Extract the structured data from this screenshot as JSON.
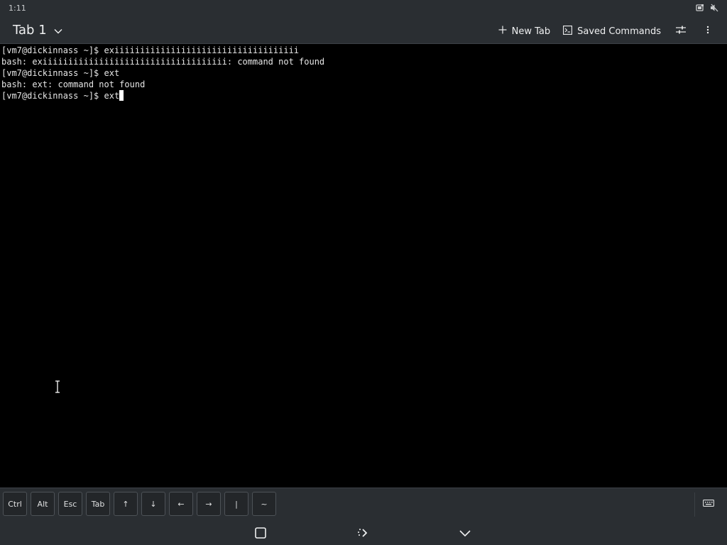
{
  "status_bar": {
    "time": "1:11",
    "icons": [
      "network-icon",
      "volume-muted-icon"
    ]
  },
  "header": {
    "tab_label": "Tab 1",
    "new_tab_label": "New Tab",
    "saved_commands_label": "Saved Commands",
    "icons": [
      "chevron-down-icon",
      "plus-icon",
      "terminal-icon",
      "settings-sliders-icon",
      "more-vertical-icon"
    ]
  },
  "terminal": {
    "lines": [
      "[vm7@dickinnass ~]$ exiiiiiiiiiiiiiiiiiiiiiiiiiiiiiiiiiiii",
      "bash: exiiiiiiiiiiiiiiiiiiiiiiiiiiiiiiiiiiii: command not found",
      "[vm7@dickinnass ~]$ ext",
      "bash: ext: command not found",
      "[vm7@dickinnass ~]$ ext"
    ],
    "background": "#000000",
    "foreground": "#e6e6e6"
  },
  "keybar": {
    "keys": [
      "Ctrl",
      "Alt",
      "Esc",
      "Tab",
      "↑",
      "↓",
      "←",
      "→",
      "|",
      "~"
    ],
    "toggle_icon": "keyboard-icon"
  },
  "navbar": {
    "icons": [
      "overview-icon",
      "rotate-icon",
      "hide-keyboard-icon"
    ]
  },
  "colors": {
    "chrome_bg": "#2a2e32",
    "chrome_text": "#eff0f1",
    "terminal_bg": "#000000",
    "terminal_text": "#e6e6e6"
  }
}
